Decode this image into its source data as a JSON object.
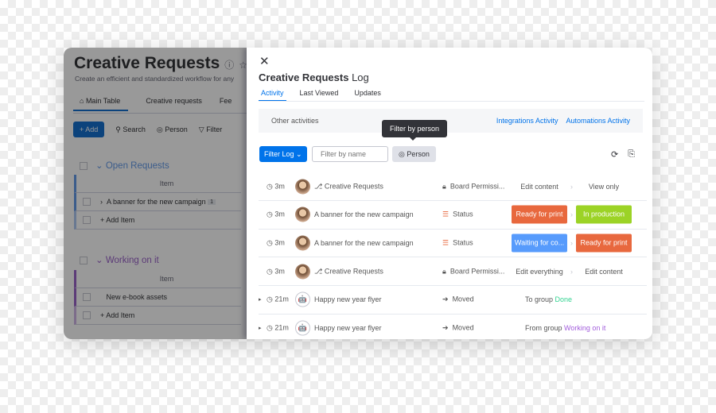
{
  "board": {
    "title": "Creative Requests",
    "subtitle": "Create an efficient and standardized workflow for any",
    "tabs": [
      "Main Table",
      "Creative requests",
      "Fee"
    ],
    "toolbar": {
      "add": "Add",
      "search": "Search",
      "person": "Person",
      "filter": "Filter"
    },
    "groups": [
      {
        "name": "Open Requests",
        "color": "#579bfc",
        "header": "Item",
        "items": [
          {
            "name": "A banner for the new campaign",
            "count": "1"
          }
        ],
        "add": "+ Add Item"
      },
      {
        "name": "Working on it",
        "color": "#a25ddc",
        "header": "Item",
        "items": [
          {
            "name": "New e-book assets"
          }
        ],
        "add": "+ Add Item"
      }
    ]
  },
  "log": {
    "title": "Creative Requests",
    "title_suffix": "Log",
    "tabs": [
      "Activity",
      "Last Viewed",
      "Updates"
    ],
    "other": "Other activities",
    "links": [
      "Integrations Activity",
      "Automations Activity"
    ],
    "tooltip": "Filter by person",
    "filter_log": "Filter Log",
    "filter_placeholder": "Filter by name",
    "person": "Person",
    "rows": [
      {
        "time": "3m",
        "target": "Creative Requests",
        "column": "Board Permissi...",
        "from": "Edit content",
        "to": "View only"
      },
      {
        "time": "3m",
        "target": "A banner for the new campaign",
        "column": "Status",
        "from": "Ready for print",
        "from_color": "#e8683e",
        "to": "In production",
        "to_color": "#9cd326"
      },
      {
        "time": "3m",
        "target": "A banner for the new campaign",
        "column": "Status",
        "from": "Waiting for co...",
        "from_color": "#579bfc",
        "to": "Ready for print",
        "to_color": "#e8683e"
      },
      {
        "time": "3m",
        "target": "Creative Requests",
        "column": "Board Permissi...",
        "from": "Edit everything",
        "to": "Edit content"
      },
      {
        "time": "21m",
        "target": "Happy new year flyer",
        "column": "Moved",
        "prefix": "To group",
        "group": "Done",
        "group_color": "#33d391"
      },
      {
        "time": "21m",
        "target": "Happy new year flyer",
        "column": "Moved",
        "prefix": "From group",
        "group": "Working on it",
        "group_color": "#a25ddc"
      }
    ]
  }
}
